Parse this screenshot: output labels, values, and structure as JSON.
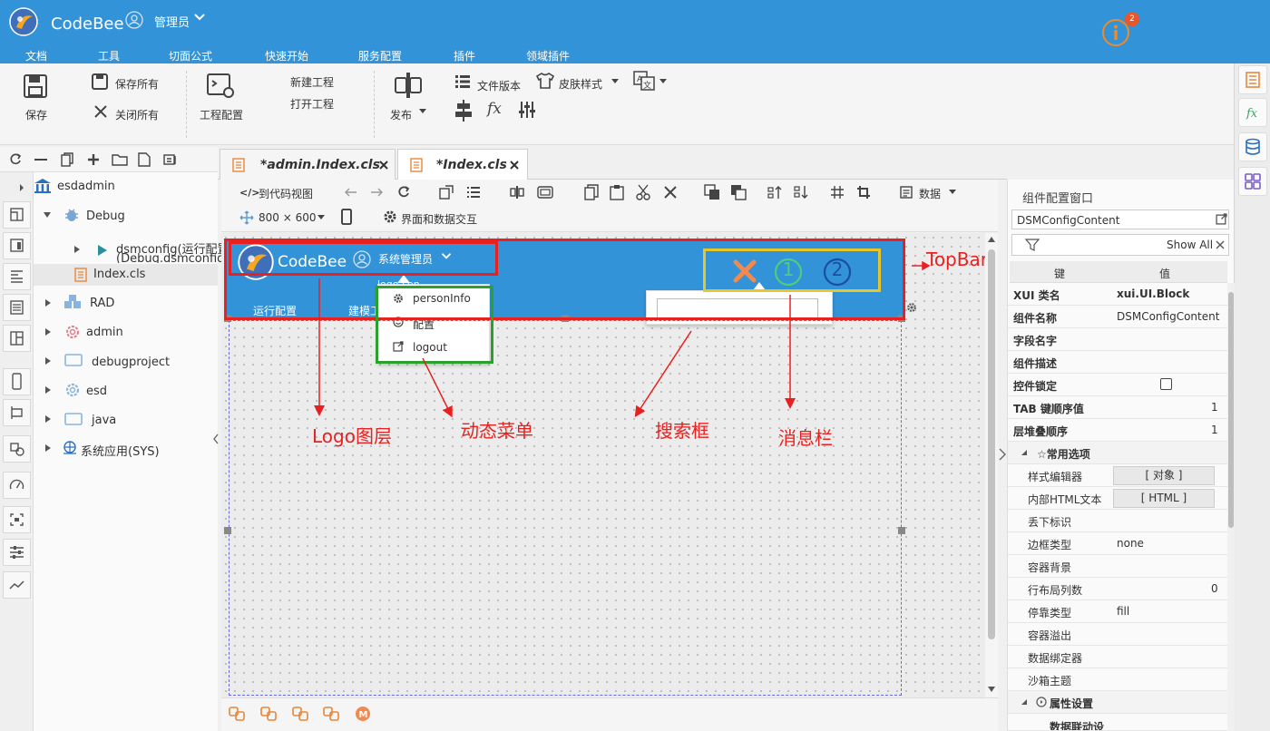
{
  "app": {
    "title": "CodeBee",
    "user": "管理员",
    "notification_count": "2"
  },
  "menu": [
    "文档",
    "工具",
    "切面公式",
    "快速开始",
    "服务配置",
    "插件",
    "领域插件"
  ],
  "ribbon": {
    "save": "保存",
    "save_all": "保存所有",
    "close_all": "关闭所有",
    "project_config": "工程配置",
    "new_project": "新建工程",
    "open_project": "打开工程",
    "publish": "发布",
    "file_version": "文件版本",
    "skin_style": "皮肤样式"
  },
  "tree": {
    "items": [
      "esdadmin",
      "Debug",
      "dsmconfig(运行配置",
      "(Debug.dsmconfig)",
      "Index.cls",
      "RAD",
      "admin",
      "debugproject",
      "esd",
      "java",
      "系统应用(SYS)"
    ]
  },
  "tabs": [
    "*admin.Index.cls",
    "*Index.cls"
  ],
  "canvas_toolbar": {
    "to_code": "到代码视图",
    "data": "数据",
    "size": "800 × 600",
    "interaction": "界面和数据交互"
  },
  "preview": {
    "brand": "CodeBee",
    "user": "系统管理员",
    "nav1": "运行配置",
    "nav2": "建模工",
    "menu": [
      "personInfo",
      "配置",
      "logout"
    ],
    "hidden": "logo  con",
    "msg1": "1",
    "msg2": "2"
  },
  "annotations": {
    "topbar": "TopBar",
    "logo": "Logo图层",
    "menu": "动态菜单",
    "search": "搜索框",
    "message": "消息栏"
  },
  "panel": {
    "title": "组件配置窗口",
    "component": "DSMConfigContent",
    "show_all": "Show All",
    "col_key": "键",
    "col_val": "值",
    "rows": [
      [
        "XUI 类名",
        "xui.UI.Block"
      ],
      [
        "组件名称",
        "DSMConfigContent"
      ],
      [
        "字段名字",
        ""
      ],
      [
        "组件描述",
        ""
      ],
      [
        "控件锁定",
        ""
      ],
      [
        "TAB 键顺序值",
        "1"
      ],
      [
        "层堆叠顺序",
        "1"
      ]
    ],
    "group1": "☆常用选项",
    "rows2": [
      [
        "样式编辑器",
        "[ 对象 ]"
      ],
      [
        "内部HTML文本",
        "[ HTML ]"
      ],
      [
        "丢下标识",
        ""
      ],
      [
        "边框类型",
        "none"
      ],
      [
        "容器背景",
        ""
      ],
      [
        "行布局列数",
        "0"
      ],
      [
        "停靠类型",
        "fill"
      ],
      [
        "容器溢出",
        ""
      ],
      [
        "数据绑定器",
        ""
      ],
      [
        "沙箱主题",
        ""
      ]
    ],
    "group2": "属性设置",
    "group3": "数据联动设"
  },
  "colors": {
    "header": "#3393d8",
    "annotation": "#e82020",
    "frame_red": "#e82020",
    "frame_green": "#2ca02c",
    "frame_yellow": "#e6c62a"
  }
}
